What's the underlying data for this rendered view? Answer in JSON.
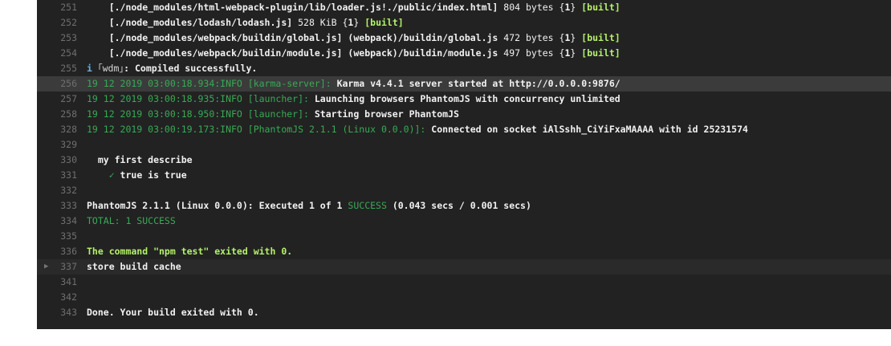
{
  "log": {
    "lines": [
      {
        "num": "251",
        "highlight": false,
        "segments": [
          {
            "text": "    [./node_modules/html-webpack-plugin/lib/loader.js!./public/index.html] ",
            "style": "bold"
          },
          {
            "text": "804 bytes {",
            "style": "white"
          },
          {
            "text": "1",
            "style": "bold"
          },
          {
            "text": "} ",
            "style": "white"
          },
          {
            "text": "[built]",
            "style": "bright-green"
          }
        ]
      },
      {
        "num": "252",
        "highlight": false,
        "segments": [
          {
            "text": "    [./node_modules/lodash/lodash.js] ",
            "style": "bold"
          },
          {
            "text": "528 KiB {",
            "style": "white"
          },
          {
            "text": "1",
            "style": "bold"
          },
          {
            "text": "} ",
            "style": "white"
          },
          {
            "text": "[built]",
            "style": "bright-green"
          }
        ]
      },
      {
        "num": "253",
        "highlight": false,
        "segments": [
          {
            "text": "    [./node_modules/webpack/buildin/global.js] ",
            "style": "bold"
          },
          {
            "text": "(webpack)/buildin/global.js ",
            "style": "bold"
          },
          {
            "text": "472 bytes {",
            "style": "white"
          },
          {
            "text": "1",
            "style": "bold"
          },
          {
            "text": "} ",
            "style": "white"
          },
          {
            "text": "[built]",
            "style": "bright-green"
          }
        ]
      },
      {
        "num": "254",
        "highlight": false,
        "segments": [
          {
            "text": "    [./node_modules/webpack/buildin/module.js] ",
            "style": "bold"
          },
          {
            "text": "(webpack)/buildin/module.js ",
            "style": "bold"
          },
          {
            "text": "497 bytes {",
            "style": "white"
          },
          {
            "text": "1",
            "style": "bold"
          },
          {
            "text": "} ",
            "style": "white"
          },
          {
            "text": "[built]",
            "style": "bright-green"
          }
        ]
      },
      {
        "num": "255",
        "highlight": false,
        "segments": [
          {
            "text": "i ",
            "style": "info"
          },
          {
            "text": "｢wdm｣",
            "style": "plain"
          },
          {
            "text": ": Compiled successfully.",
            "style": "bold"
          }
        ]
      },
      {
        "num": "256",
        "highlight": true,
        "segments": [
          {
            "text": "19 12 2019 03:00:18.934:INFO [karma-server]: ",
            "style": "green"
          },
          {
            "text": "Karma v4.4.1 server started at http://0.0.0.0:9876/",
            "style": "bold"
          }
        ]
      },
      {
        "num": "257",
        "highlight": false,
        "segments": [
          {
            "text": "19 12 2019 03:00:18.935:INFO [launcher]: ",
            "style": "green"
          },
          {
            "text": "Launching browsers PhantomJS with concurrency unlimited",
            "style": "bold"
          }
        ]
      },
      {
        "num": "258",
        "highlight": false,
        "segments": [
          {
            "text": "19 12 2019 03:00:18.950:INFO [launcher]: ",
            "style": "green"
          },
          {
            "text": "Starting browser PhantomJS",
            "style": "bold"
          }
        ]
      },
      {
        "num": "328",
        "highlight": false,
        "segments": [
          {
            "text": "19 12 2019 03:00:19.173:INFO [PhantomJS 2.1.1 (Linux 0.0.0)]: ",
            "style": "green"
          },
          {
            "text": "Connected on socket iAlSshh_CiYiFxaMAAAA with id 25231574",
            "style": "bold"
          }
        ]
      },
      {
        "num": "329",
        "highlight": false,
        "segments": []
      },
      {
        "num": "330",
        "highlight": false,
        "segments": [
          {
            "text": "  my first describe",
            "style": "bold"
          }
        ]
      },
      {
        "num": "331",
        "highlight": false,
        "segments": [
          {
            "text": "    ✓ ",
            "style": "green"
          },
          {
            "text": "true is true",
            "style": "bold"
          }
        ]
      },
      {
        "num": "332",
        "highlight": false,
        "segments": []
      },
      {
        "num": "333",
        "highlight": false,
        "segments": [
          {
            "text": "PhantomJS 2.1.1 (Linux 0.0.0): Executed 1 of 1 ",
            "style": "bold"
          },
          {
            "text": "SUCCESS",
            "style": "green"
          },
          {
            "text": " (0.043 secs / 0.001 secs)",
            "style": "bold"
          }
        ]
      },
      {
        "num": "334",
        "highlight": false,
        "segments": [
          {
            "text": "TOTAL: 1 SUCCESS",
            "style": "green"
          }
        ]
      },
      {
        "num": "335",
        "highlight": false,
        "segments": []
      },
      {
        "num": "336",
        "highlight": false,
        "segments": [
          {
            "text": "The command \"npm test\" exited with 0.",
            "style": "bright-green"
          }
        ]
      },
      {
        "num": "337",
        "highlight": false,
        "fold": true,
        "segments": [
          {
            "text": "store build cache",
            "style": "bold"
          }
        ]
      },
      {
        "num": "341",
        "highlight": false,
        "segments": []
      },
      {
        "num": "342",
        "highlight": false,
        "segments": []
      },
      {
        "num": "343",
        "highlight": false,
        "segments": [
          {
            "text": "Done. Your build exited with 0.",
            "style": "bold"
          }
        ]
      }
    ]
  },
  "colors": {
    "terminal_background": "#222222",
    "line_number": "#6f6f6f",
    "success_green": "#39aa56",
    "built_green": "#b5f06b",
    "highlight_row": "#3b3b3b"
  },
  "icons": {
    "fold": "caret-right-icon",
    "info": "info-icon",
    "check": "checkmark-icon"
  }
}
